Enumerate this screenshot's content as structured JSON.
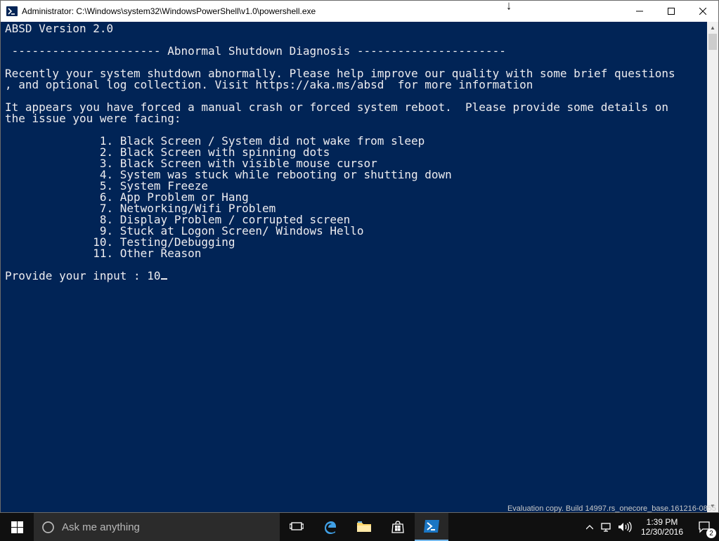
{
  "window": {
    "title": "Administrator: C:\\Windows\\system32\\WindowsPowerShell\\v1.0\\powershell.exe"
  },
  "console": {
    "version_line": "ABSD Version 2.0",
    "rule": " ---------------------- ",
    "heading": "Abnormal Shutdown Diagnosis",
    "intro1": "Recently your system shutdown abnormally. Please help improve our quality with some brief questions",
    "intro2": ", and optional log collection. Visit https://aka.ms/absd  for more information",
    "prompt_intro1": "It appears you have forced a manual crash or forced system reboot.  Please provide some details on",
    "prompt_intro2": "the issue you were facing:",
    "options": [
      "1. Black Screen / System did not wake from sleep",
      "2. Black Screen with spinning dots",
      "3. Black Screen with visible mouse cursor",
      "4. System was stuck while rebooting or shutting down",
      "5. System Freeze",
      "6. App Problem or Hang",
      "7. Networking/Wifi Problem",
      "8. Display Problem / corrupted screen",
      "9. Stuck at Logon Screen/ Windows Hello",
      "10. Testing/Debugging",
      "11. Other Reason"
    ],
    "input_label": "Provide your input : ",
    "input_value": "10"
  },
  "taskbar": {
    "search_placeholder": "Ask me anything",
    "clock_time": "1:39 PM",
    "clock_date": "12/30/2016",
    "action_center_count": "2"
  },
  "desktop": {
    "eval_text": "Evaluation copy. Build 14997.rs_onecore_base.161216-0855"
  }
}
